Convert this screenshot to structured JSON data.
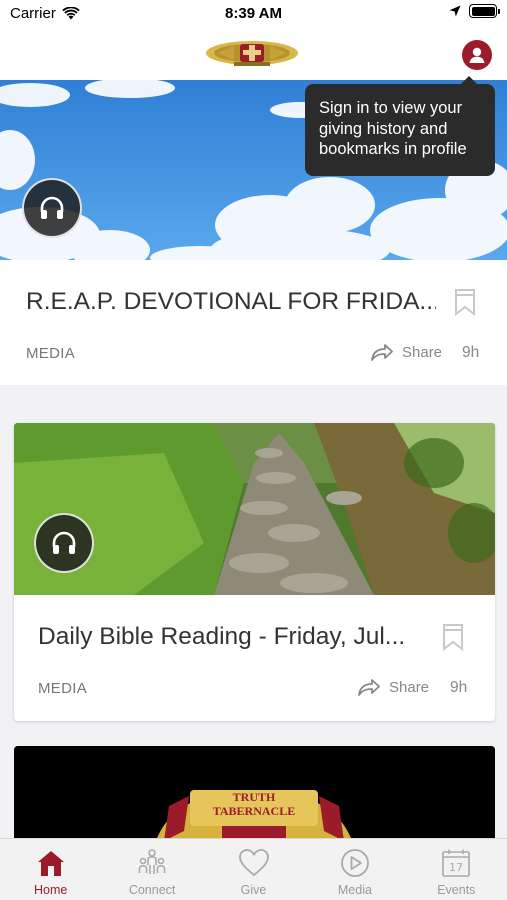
{
  "status_bar": {
    "carrier": "Carrier",
    "time": "8:39 AM"
  },
  "tooltip": {
    "text": "Sign in to view your giving history and bookmarks in profile"
  },
  "feed": {
    "items": [
      {
        "title": "R.E.A.P. DEVOTIONAL FOR FRIDA...",
        "category": "MEDIA",
        "share_label": "Share",
        "age": "9h",
        "image": "sky with clouds"
      },
      {
        "title": "Daily Bible Reading - Friday, Jul...",
        "category": "MEDIA",
        "share_label": "Share",
        "age": "9h",
        "image": "stone path in green forest"
      },
      {
        "logo_text_line1": "TRUTH",
        "logo_text_line2": "TABERNACLE"
      }
    ]
  },
  "tab_bar": {
    "tabs": [
      {
        "label": "Home",
        "icon": "home-icon",
        "active": true
      },
      {
        "label": "Connect",
        "icon": "connect-icon",
        "active": false
      },
      {
        "label": "Give",
        "icon": "heart-icon",
        "active": false
      },
      {
        "label": "Media",
        "icon": "play-icon",
        "active": false
      },
      {
        "label": "Events",
        "icon": "calendar-icon",
        "active": false
      }
    ],
    "events_calendar_day": "17"
  },
  "colors": {
    "accent": "#9b1b2a",
    "tooltip_bg": "#2b2b2b",
    "inactive_tab": "#999999"
  }
}
